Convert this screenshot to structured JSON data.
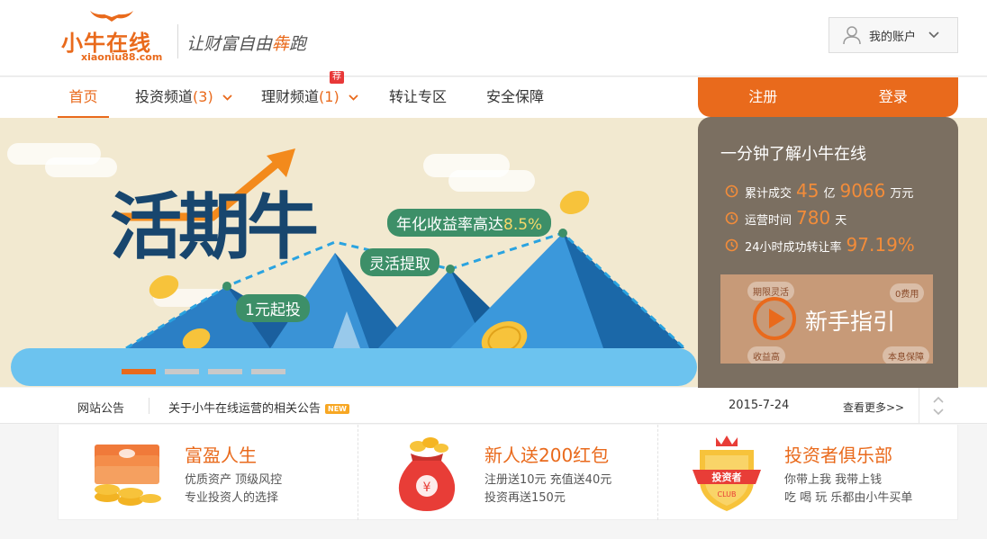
{
  "header": {
    "logo_name": "小牛在线",
    "logo_url": "xiaoniu88.com",
    "slogan_prefix": "让财富自由",
    "slogan_highlight": "犇",
    "slogan_suffix": "跑",
    "account_label": "我的账户"
  },
  "nav": {
    "items": [
      {
        "label": "首页"
      },
      {
        "label": "投资频道",
        "count": "(3)"
      },
      {
        "label": "理财频道",
        "count": "(1)",
        "badge": "荐"
      },
      {
        "label": "转让专区"
      },
      {
        "label": "安全保障"
      }
    ]
  },
  "auth": {
    "register": "注册",
    "login": "登录"
  },
  "banner": {
    "title": "活期牛",
    "tag_start": "1元起投",
    "tag_flexible": "灵活提取",
    "tag_rate_prefix": "年化收益率高达",
    "tag_rate_value": "8.5%"
  },
  "info": {
    "title": "一分钟了解小牛在线",
    "stats": [
      {
        "label": "累计成交",
        "v1": "45",
        "u1": "亿",
        "v2": "9066",
        "u2": "万元"
      },
      {
        "label": "运营时间",
        "v1": "780",
        "u1": "天"
      },
      {
        "label": "24小时成功转让率",
        "v1": "97.19%"
      }
    ],
    "guide_label": "新手指引",
    "guide_chips": [
      "期限灵活",
      "0费用",
      "收益高",
      "本息保障"
    ]
  },
  "notice": {
    "label": "网站公告",
    "text": "关于小牛在线运营的相关公告",
    "new_badge": "NEW",
    "date": "2015-7-24",
    "more": "查看更多>>"
  },
  "features": [
    {
      "title": "富盈人生",
      "line1": "优质资产 顶级风控",
      "line2": "专业投资人的选择",
      "icon": "coins-stack-icon"
    },
    {
      "title": "新人送200红包",
      "line1": "注册送10元 充值送40元",
      "line2": "投资再送150元",
      "icon": "red-envelope-icon"
    },
    {
      "title": "投资者俱乐部",
      "line1": "你带上我 我带上钱",
      "line2": "吃 喝 玩 乐都由小牛买单",
      "icon": "investor-club-shield-icon",
      "icon_text": "投资者",
      "icon_sub": "CLUB"
    }
  ],
  "colors": {
    "brand": "#e96a1c",
    "panel": "#7b6f61",
    "banner_bg": "#f2e9d0",
    "title_blue": "#18466e",
    "tag_green": "#3d8f68"
  }
}
